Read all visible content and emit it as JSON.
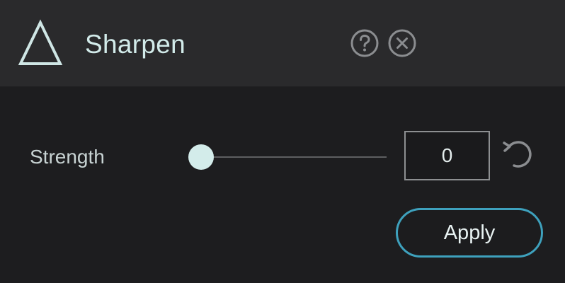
{
  "header": {
    "title": "Sharpen",
    "tool_icon": "triangle-icon",
    "help_icon": "help-icon",
    "close_icon": "close-icon"
  },
  "controls": {
    "strength": {
      "label": "Strength",
      "value": "0",
      "slider_level": 0,
      "reset_icon": "reset-icon"
    }
  },
  "actions": {
    "apply_label": "Apply"
  },
  "colors": {
    "background": "#1d1d1f",
    "header": "#2a2a2c",
    "accent": "#3ea1bd",
    "title_text": "#d2ebea",
    "slider_handle": "#d3ecea"
  }
}
